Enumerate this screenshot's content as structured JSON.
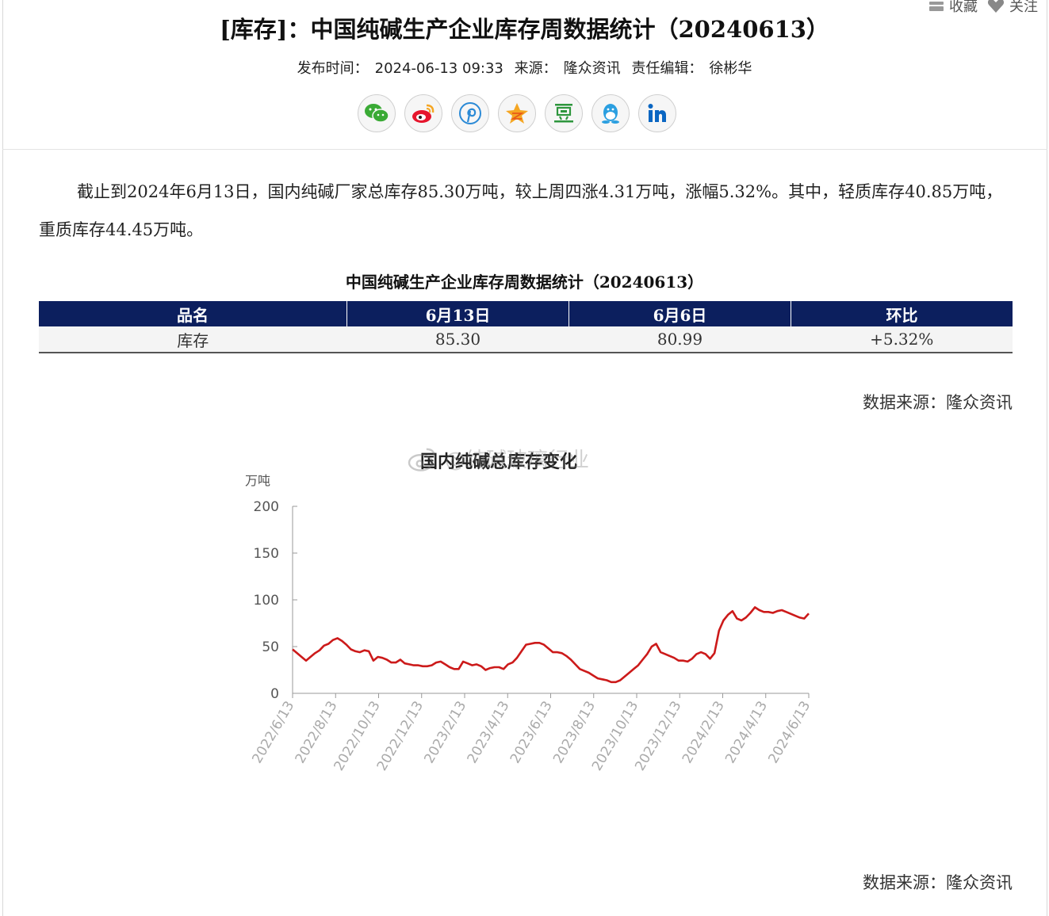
{
  "header": {
    "favorite_label": "收藏",
    "follow_label": "关注"
  },
  "article": {
    "title": "[库存]：中国纯碱生产企业库存周数据统计（20240613）",
    "publish_label": "发布时间：",
    "publish_time": "2024-06-13 09:33",
    "source_label": "来源：",
    "source": "隆众资讯",
    "editor_label": "责任编辑：",
    "editor": "徐彬华",
    "paragraph": "截止到2024年6月13日，国内纯碱厂家总库存85.30万吨，较上周四涨4.31万吨，涨幅5.32%。其中，轻质库存40.85万吨，重质库存44.45万吨。"
  },
  "share": {
    "icons": [
      "wechat-icon",
      "weibo-icon",
      "pinterest-icon",
      "qzone-icon",
      "douban-icon",
      "qq-icon",
      "linkedin-icon"
    ],
    "colors": {
      "wechat": "#3aaa35",
      "weibo": "#e6162d",
      "pinterest": "#2b8ad6",
      "qzone": "#f5a623",
      "douban": "#2e963d",
      "qq": "#2b9fe0",
      "linkedin": "#0a66c2"
    }
  },
  "table": {
    "title": "中国纯碱生产企业库存周数据统计（20240613）",
    "headers": [
      "品名",
      "6月13日",
      "6月6日",
      "环比"
    ],
    "rows": [
      [
        "库存",
        "85.30",
        "80.99",
        "+5.32%"
      ]
    ],
    "header_bg": "#0c1f5e"
  },
  "source_note_1": "数据来源：隆众资讯",
  "source_note_2": "数据来源：隆众资讯",
  "watermark_text": "@纯碱玻璃行业",
  "chart_data": {
    "type": "line",
    "title": "国内纯碱总库存变化",
    "ylabel": "万吨",
    "ylim": [
      0,
      200
    ],
    "yticks": [
      0,
      50,
      100,
      150,
      200
    ],
    "xticks": [
      "2022/6/13",
      "2022/8/13",
      "2022/10/13",
      "2022/12/13",
      "2023/2/13",
      "2023/4/13",
      "2023/6/13",
      "2023/8/13",
      "2023/10/13",
      "2023/12/13",
      "2024/2/13",
      "2024/4/13",
      "2024/6/13"
    ],
    "color": "#cc1a1a",
    "grid": false,
    "series": [
      {
        "values": [
          47,
          43,
          39,
          35,
          39,
          43,
          46,
          51,
          53,
          57,
          59,
          56,
          52,
          47,
          45,
          44,
          46,
          45,
          35,
          39,
          38,
          36,
          33,
          33,
          36,
          32,
          31,
          30,
          30,
          29,
          29,
          30,
          33,
          34,
          31,
          28,
          26,
          26,
          34,
          32,
          30,
          31,
          29,
          25,
          27,
          28,
          28,
          26,
          31,
          33,
          38,
          45,
          52,
          53,
          54,
          54,
          52,
          48,
          44,
          44,
          43,
          40,
          36,
          31,
          26,
          24,
          22,
          19,
          16,
          15,
          14,
          12,
          12,
          14,
          18,
          22,
          26,
          30,
          36,
          42,
          50,
          53,
          44,
          42,
          40,
          38,
          35,
          35,
          34,
          37,
          42,
          44,
          42,
          37,
          43,
          67,
          78,
          84,
          88,
          80,
          78,
          81,
          86,
          92,
          89,
          87,
          87,
          86,
          88,
          89,
          87,
          85,
          83,
          81,
          80,
          85.3
        ]
      }
    ]
  }
}
